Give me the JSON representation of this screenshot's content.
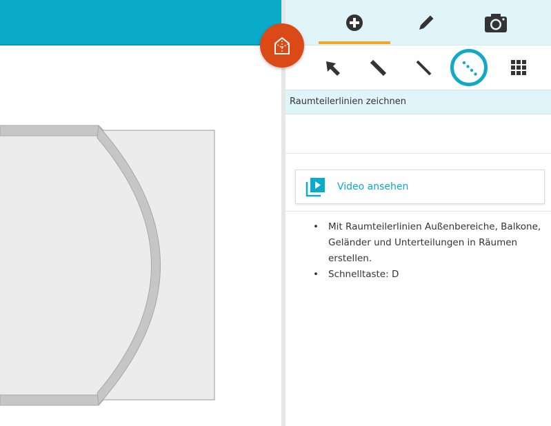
{
  "tabs": [
    {
      "name": "add-icon",
      "active": true
    },
    {
      "name": "pencil-icon",
      "active": false
    },
    {
      "name": "camera-icon",
      "active": false
    }
  ],
  "tools": [
    {
      "name": "select-arrow-icon",
      "selected": false
    },
    {
      "name": "wall-line-icon",
      "selected": false
    },
    {
      "name": "line-icon",
      "selected": false
    },
    {
      "name": "dotted-divider-line-icon",
      "selected": true
    },
    {
      "name": "grid-icon",
      "selected": false
    }
  ],
  "tool_title": "Raumteilerlinien zeichnen",
  "video": {
    "label": "Video ansehen",
    "icon": "video-play-icon"
  },
  "tips": [
    "Mit Raumteilerlinien Außenbereiche, Balkone, Geländer und Unterteilungen in Räumen erstellen.",
    "Schnelltaste: D"
  ],
  "colors": {
    "accent": "#0aaac9",
    "tab_indicator": "#f5a623",
    "logo": "#db4a16",
    "panel_bg": "#e0f5f9"
  }
}
